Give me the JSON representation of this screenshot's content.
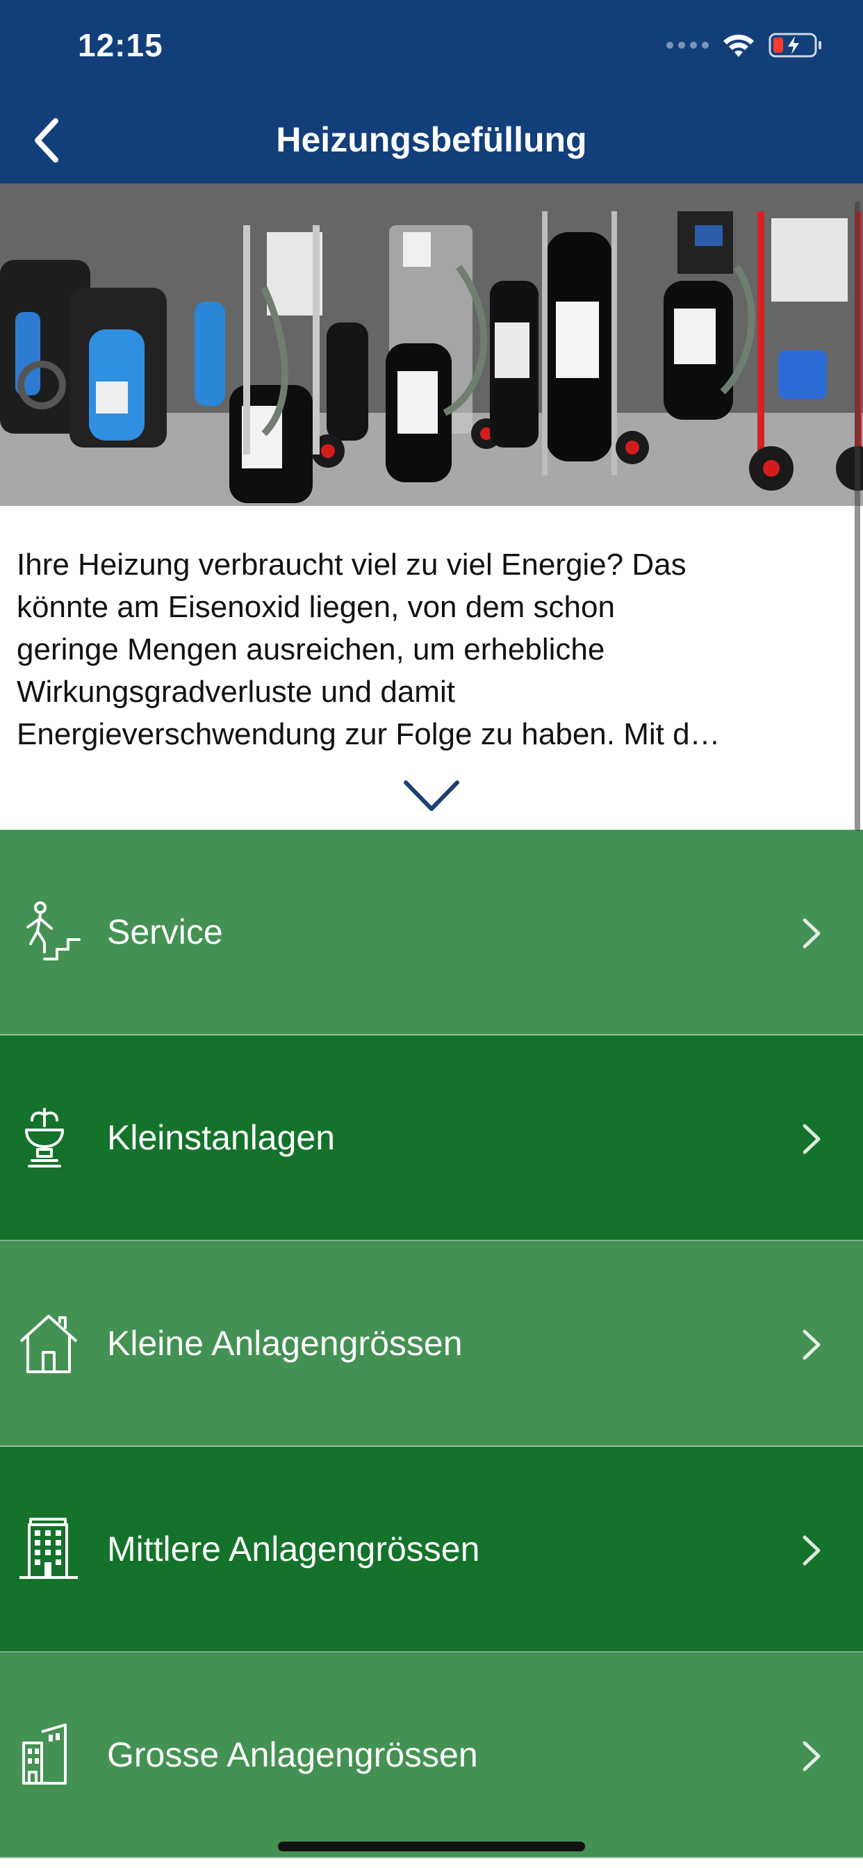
{
  "status_bar": {
    "time": "12:15"
  },
  "nav": {
    "title": "Heizungsbefüllung"
  },
  "description": {
    "lines": [
      "Ihre Heizung verbraucht viel zu viel Energie? Das",
      "könnte am Eisenoxid liegen, von dem schon",
      "geringe Mengen ausreichen, um erhebliche",
      "Wirkungsgradverluste und damit",
      "Energieverschwendung zur Folge zu haben. Mit d…"
    ]
  },
  "menu": [
    {
      "label": "Service",
      "icon": "stairs-person-icon"
    },
    {
      "label": "Kleinstanlagen",
      "icon": "fountain-icon"
    },
    {
      "label": "Kleine Anlagengrössen",
      "icon": "house-icon"
    },
    {
      "label": "Mittlere Anlagengrössen",
      "icon": "building-icon"
    },
    {
      "label": "Grosse Anlagengrössen",
      "icon": "tall-buildings-icon"
    }
  ],
  "colors": {
    "header_bg": "#123f7a",
    "menu_light": "#439153",
    "menu_dark": "#14722b"
  }
}
